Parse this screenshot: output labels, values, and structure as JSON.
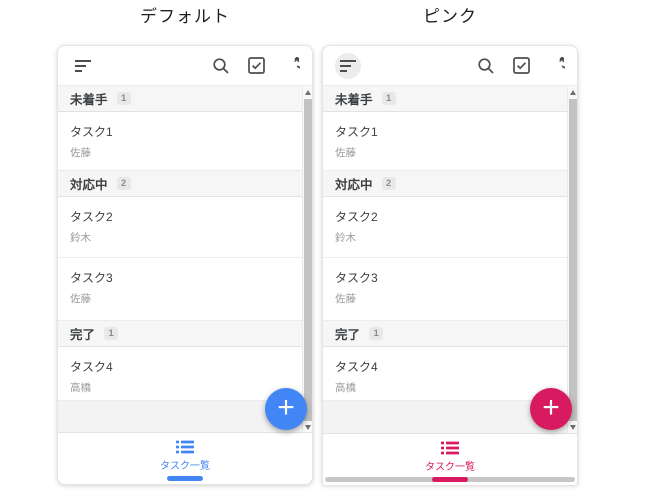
{
  "panels": [
    {
      "title": "デフォルト",
      "accent": "#4285F4",
      "toolbar_icons": [
        "sort-icon",
        "search-icon",
        "select-all-checkbox-icon",
        "refresh-icon"
      ],
      "sections": [
        {
          "label": "未着手",
          "count": "1",
          "tasks": [
            {
              "title": "タスク1",
              "assignee": "佐藤"
            }
          ]
        },
        {
          "label": "対応中",
          "count": "2",
          "tasks": [
            {
              "title": "タスク2",
              "assignee": "鈴木"
            },
            {
              "title": "タスク3",
              "assignee": "佐藤"
            }
          ]
        },
        {
          "label": "完了",
          "count": "1",
          "tasks": [
            {
              "title": "タスク4",
              "assignee": "高橋"
            }
          ]
        }
      ],
      "fab_label": "+",
      "tab_label": "タスク一覧"
    },
    {
      "title": "ピンク",
      "accent": "#D81B60",
      "toolbar_icons": [
        "sort-icon",
        "search-icon",
        "select-all-checkbox-icon",
        "refresh-icon"
      ],
      "sections": [
        {
          "label": "未着手",
          "count": "1",
          "tasks": [
            {
              "title": "タスク1",
              "assignee": "佐藤"
            }
          ]
        },
        {
          "label": "対応中",
          "count": "2",
          "tasks": [
            {
              "title": "タスク2",
              "assignee": "鈴木"
            },
            {
              "title": "タスク3",
              "assignee": "佐藤"
            }
          ]
        },
        {
          "label": "完了",
          "count": "1",
          "tasks": [
            {
              "title": "タスク4",
              "assignee": "高橋"
            }
          ]
        }
      ],
      "fab_label": "+",
      "tab_label": "タスク一覧"
    }
  ]
}
